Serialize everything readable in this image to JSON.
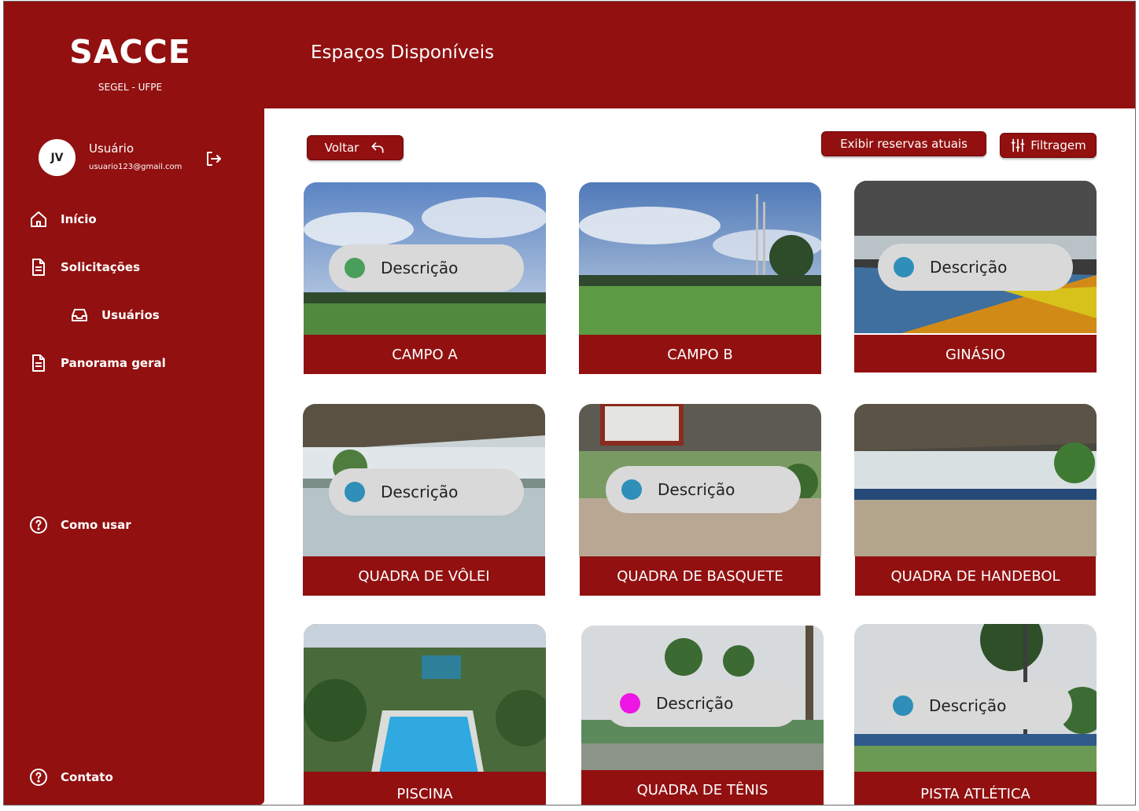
{
  "app": {
    "title": "SACCE",
    "subtitle": "SEGEL - UFPE"
  },
  "header": {
    "title": "Espaços Disponíveis"
  },
  "user": {
    "initials": "JV",
    "name": "Usuário",
    "email": "usuario123@gmail.com"
  },
  "nav": {
    "inicio": "Início",
    "solicitacoes": "Solicitações",
    "usuarios": "Usuários",
    "panorama": "Panorama geral",
    "como_usar": "Como usar",
    "contato": "Contato"
  },
  "toolbar": {
    "back": "Voltar",
    "reservas": "Exibir reservas atuais",
    "filter": "Filtragem"
  },
  "cards": [
    {
      "label": "CAMPO A",
      "description": "Descrição",
      "status_color": "#4a9e5c"
    },
    {
      "label": "CAMPO B"
    },
    {
      "label": "GINÁSIO",
      "description": "Descrição",
      "status_color": "#2f8fb8"
    },
    {
      "label": "QUADRA DE VÔLEI",
      "description": "Descrição",
      "status_color": "#2f8fb8"
    },
    {
      "label": "QUADRA DE BASQUETE",
      "description": "Descrição",
      "status_color": "#2f8fb8"
    },
    {
      "label": "QUADRA DE HANDEBOL"
    },
    {
      "label": "PISCINA"
    },
    {
      "label": "QUADRA DE TÊNIS",
      "description": "Descrição",
      "status_color": "#ee16e4"
    },
    {
      "label": "PISTA ATLÉTICA",
      "description": "Descrição",
      "status_color": "#2f8fb8"
    }
  ],
  "colors": {
    "brand": "#921010",
    "pill": "#d9d9d9"
  }
}
